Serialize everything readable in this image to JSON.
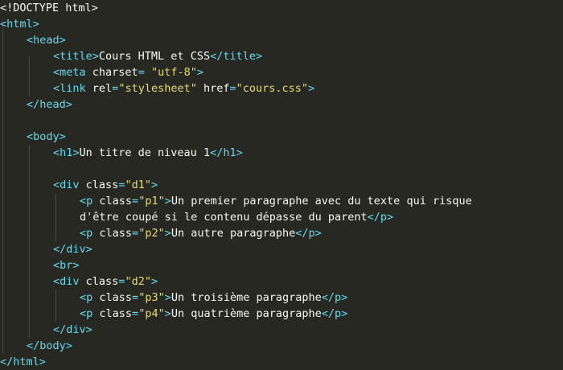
{
  "code": {
    "doctype": "<!DOCTYPE html>",
    "html_open": "<html>",
    "head_open": "<head>",
    "title_open": "<title>",
    "title_text": "Cours HTML et CSS",
    "title_close": "</title>",
    "meta_open": "<meta",
    "meta_attr": "charset",
    "meta_eq": "= ",
    "meta_value": "\"utf-8\"",
    "meta_close": ">",
    "link_open": "<link",
    "link_rel_attr": "rel",
    "link_rel_eq": "=",
    "link_rel_value": "\"stylesheet\"",
    "link_href_attr": "href",
    "link_href_eq": "=",
    "link_href_value": "\"cours.css\"",
    "link_close": ">",
    "head_close": "</head>",
    "body_open": "<body>",
    "h1_open": "<h1>",
    "h1_text": "Un titre de niveau 1",
    "h1_close": "</h1>",
    "div1_open": "<div",
    "div1_attr": "class",
    "div1_eq": "=",
    "div1_value": "\"d1\"",
    "div1_end": ">",
    "p1_open": "<p",
    "p1_attr": "class",
    "p1_eq": "=",
    "p1_value": "\"p1\"",
    "p1_end": ">",
    "p1_text_a": "Un premier paragraphe avec du texte qui risque",
    "p1_text_b": "d'être coupé si le contenu dépasse du parent",
    "p1_close": "</p>",
    "p2_open": "<p",
    "p2_attr": "class",
    "p2_eq": "=",
    "p2_value": "\"p2\"",
    "p2_end": ">",
    "p2_text": "Un autre paragraphe",
    "p2_close": "</p>",
    "div1_close": "</div>",
    "br": "<br>",
    "div2_open": "<div",
    "div2_attr": "class",
    "div2_eq": "=",
    "div2_value": "\"d2\"",
    "div2_end": ">",
    "p3_open": "<p",
    "p3_attr": "class",
    "p3_eq": "=",
    "p3_value": "\"p3\"",
    "p3_end": ">",
    "p3_text": "Un troisième paragraphe",
    "p3_close": "</p>",
    "p4_open": "<p",
    "p4_attr": "class",
    "p4_eq": "=",
    "p4_value": "\"p4\"",
    "p4_end": ">",
    "p4_text": "Un quatrième paragraphe",
    "p4_close": "</p>",
    "div2_close": "</div>",
    "body_close": "</body>",
    "html_close": "</html>"
  },
  "colors": {
    "background": "#272822",
    "tag": "#66d9ef",
    "attribute": "#f8f8f2",
    "string": "#e6db74",
    "text": "#f8f8f2",
    "indent_guide": "#4a4b44"
  }
}
